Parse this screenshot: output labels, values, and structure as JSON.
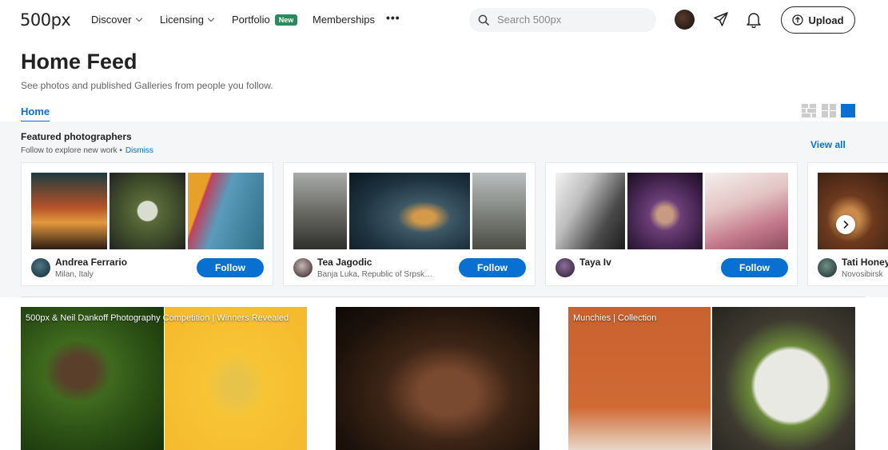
{
  "nav": {
    "logo": "500px",
    "items": [
      {
        "label": "Discover"
      },
      {
        "label": "Licensing"
      },
      {
        "label": "Portfolio",
        "badge": "New"
      },
      {
        "label": "Memberships"
      }
    ],
    "more": "•••",
    "search_placeholder": "Search 500px",
    "upload_label": "Upload",
    "icons": [
      "search-icon",
      "send-icon",
      "bell-icon",
      "upload-arrow-icon"
    ]
  },
  "header": {
    "title": "Home Feed",
    "subtitle": "See photos and published Galleries from people you follow.",
    "tab": "Home"
  },
  "featured": {
    "title": "Featured photographers",
    "subtitle": "Follow to explore new work •",
    "dismiss": "Dismiss",
    "view_all": "View all",
    "follow_label": "Follow",
    "photographers": [
      {
        "name": "Andrea Ferrario",
        "location": "Milan, Italy"
      },
      {
        "name": "Tea Jagodic",
        "location": "Banja Luka, Republic of Srpsk…"
      },
      {
        "name": "Taya Iv",
        "location": ""
      },
      {
        "name": "Tati Honey",
        "location": "Novosibirsk"
      }
    ]
  },
  "galleries": [
    {
      "caption": "500px & Neil Dankoff Photography Competition | Winners Revealed"
    },
    {
      "caption": ""
    },
    {
      "caption": "Munchies | Collection"
    }
  ],
  "colors": {
    "accent": "#0870d1",
    "badge": "#2a8a5c"
  }
}
